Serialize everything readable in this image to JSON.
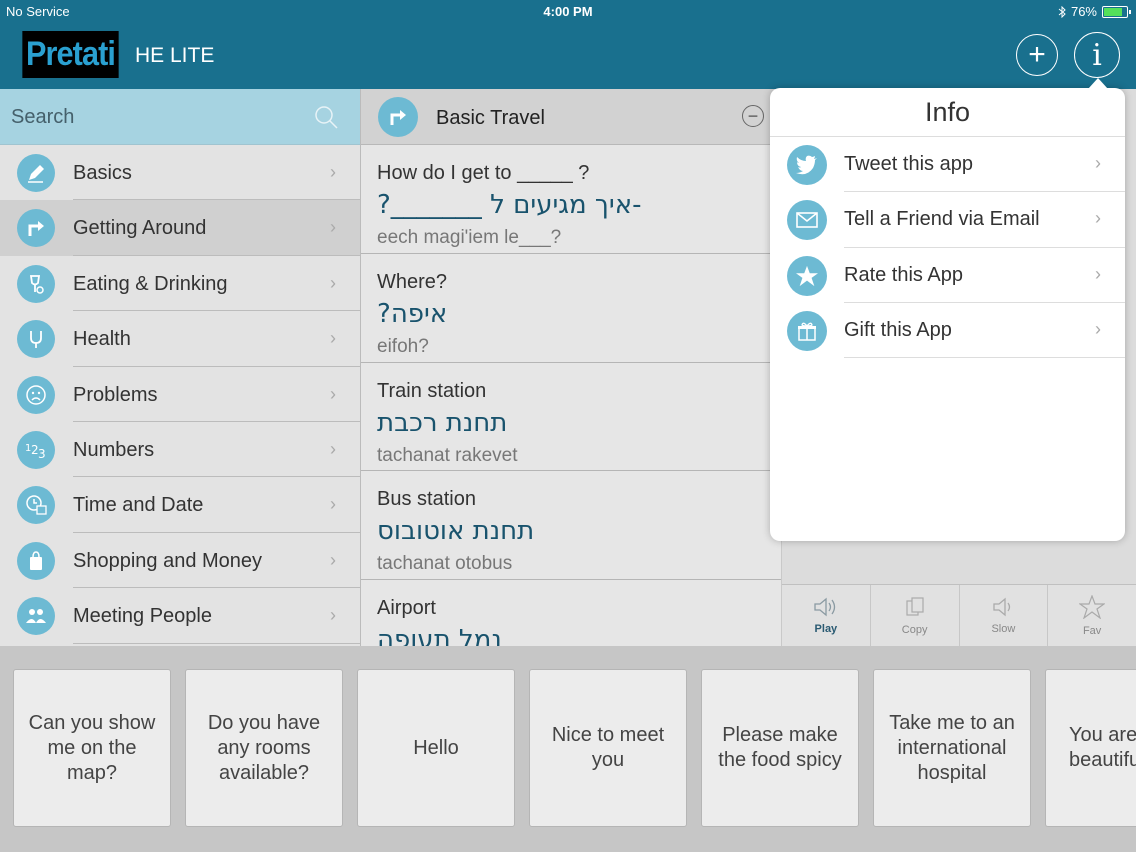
{
  "status": {
    "carrier": "No Service",
    "time": "4:00 PM",
    "battery": "76%",
    "battery_level": 0.76
  },
  "header": {
    "logo": "Pretati",
    "app_name": "HE LITE"
  },
  "search": {
    "placeholder": "Search"
  },
  "categories": [
    {
      "label": "Basics",
      "icon": "pencil-icon"
    },
    {
      "label": "Getting Around",
      "icon": "turn-arrow-icon"
    },
    {
      "label": "Eating & Drinking",
      "icon": "glass-fork-icon"
    },
    {
      "label": "Health",
      "icon": "stethoscope-icon"
    },
    {
      "label": "Problems",
      "icon": "sad-face-icon"
    },
    {
      "label": "Numbers",
      "icon": "numbers-icon"
    },
    {
      "label": "Time and Date",
      "icon": "clock-calendar-icon"
    },
    {
      "label": "Shopping and Money",
      "icon": "shopping-bag-icon"
    },
    {
      "label": "Meeting People",
      "icon": "people-icon"
    }
  ],
  "section": {
    "title": "Basic Travel"
  },
  "phrases": [
    {
      "en": "How do I get to _____ ?",
      "he": "?_______ איך מגיעים ל-",
      "tr": "eech magi'iem le___?"
    },
    {
      "en": "Where?",
      "he": "?איפה",
      "tr": "eifoh?"
    },
    {
      "en": "Train station",
      "he": "תחנת רכבת",
      "tr": "tachanat rakevet"
    },
    {
      "en": "Bus station",
      "he": "תחנת אוטובוס",
      "tr": "tachanat otobus"
    },
    {
      "en": "Airport",
      "he": "נמל תעופה",
      "tr": ""
    }
  ],
  "toolbar": [
    {
      "label": "Play",
      "icon": "speaker-icon"
    },
    {
      "label": "Copy",
      "icon": "copy-icon"
    },
    {
      "label": "Slow",
      "icon": "speaker-slow-icon"
    },
    {
      "label": "Fav",
      "icon": "star-icon"
    }
  ],
  "info": {
    "title": "Info",
    "items": [
      {
        "label": "Tweet this app",
        "icon": "twitter-icon"
      },
      {
        "label": "Tell a Friend via Email",
        "icon": "envelope-icon"
      },
      {
        "label": "Rate this App",
        "icon": "star-icon"
      },
      {
        "label": "Gift this App",
        "icon": "gift-icon"
      }
    ]
  },
  "cards": [
    "Can you show me on the map?",
    "Do you have any rooms available?",
    "Hello",
    "Nice to meet you",
    "Please make the food spicy",
    "Take me to an international hospital",
    "You are beautiful"
  ],
  "colors": {
    "header": "#19708e",
    "accent": "#6dbad3",
    "search_bg": "#a6d3e1"
  }
}
